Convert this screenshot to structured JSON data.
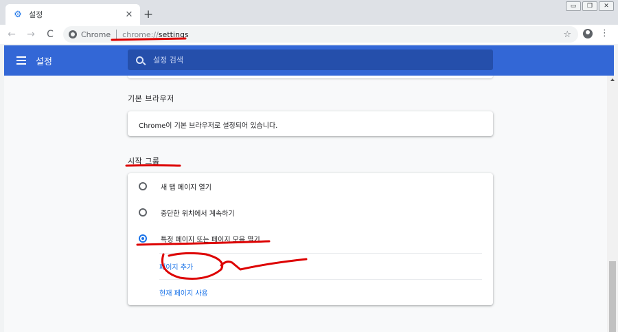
{
  "tab": {
    "title": "설정",
    "icon": "gear-icon",
    "close_glyph": "✕"
  },
  "new_tab_glyph": "+",
  "window_controls": [
    "▭",
    "❐",
    "✕"
  ],
  "toolbar": {
    "back_glyph": "←",
    "forward_glyph": "→",
    "reload_glyph": "C",
    "chip_label": "Chrome",
    "url_scheme": "chrome://",
    "url_path": "settings",
    "star_glyph": "☆",
    "menu_glyph": "⋮"
  },
  "header": {
    "title": "설정",
    "search_placeholder": "설정 검색"
  },
  "sections": {
    "default_browser": {
      "title": "기본 브라우저",
      "status": "Chrome이 기본 브라우저로 설정되어 있습니다."
    },
    "startup": {
      "title": "시작 그룹",
      "options": [
        {
          "label": "새 탭 페이지 열기",
          "checked": false
        },
        {
          "label": "중단한 위치에서 계속하기",
          "checked": false
        },
        {
          "label": "특정 페이지 또는 페이지 모음 열기",
          "checked": true
        }
      ],
      "links": [
        "페이지 추가",
        "현재 페이지 사용"
      ]
    }
  },
  "colors": {
    "header_blue": "#3367d6",
    "accent": "#1a73e8",
    "annotation_red": "#dd0000"
  }
}
